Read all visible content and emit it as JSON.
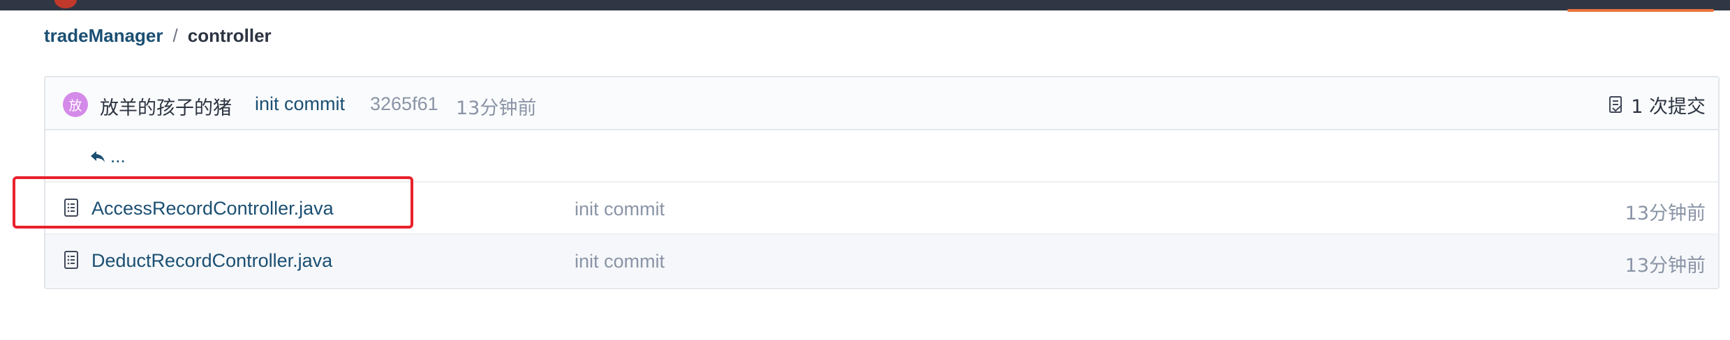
{
  "breadcrumb": {
    "root": "tradeManager",
    "separator": "/",
    "current": "controller"
  },
  "commit": {
    "avatar_char": "放",
    "author": "放羊的孩子的猪",
    "message": "init commit",
    "hash": "3265f61",
    "time": "13分钟前",
    "count_label": "1 次提交"
  },
  "up_link": "...",
  "files": [
    {
      "name": "AccessRecordController.java",
      "commit": "init commit",
      "time": "13分钟前"
    },
    {
      "name": "DeductRecordController.java",
      "commit": "init commit",
      "time": "13分钟前"
    }
  ],
  "colors": {
    "topbar": "#303643",
    "link": "#1b4f72",
    "avatar": "#d48ae8",
    "highlight": "#e8212b",
    "accent": "#e8743b"
  },
  "icons": {
    "commit_count": "commit-history-icon",
    "up": "reply-arrow-icon",
    "file": "file-text-icon"
  }
}
